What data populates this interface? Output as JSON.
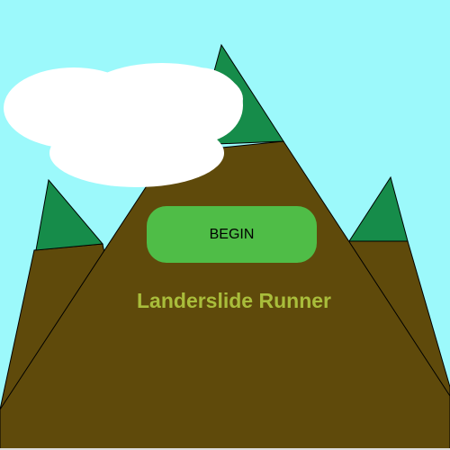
{
  "colors": {
    "sky": "#9cf9fb",
    "mountain": "#5f4a0b",
    "snowcap": "#168c4a",
    "cloud": "#ffffff",
    "button": "#4fbd47",
    "title": "#a9bd3b",
    "button_text": "#000000",
    "border": "#000000",
    "page_border": "#dddddd"
  },
  "menu": {
    "begin_label": "BEGIN",
    "title": "Landerslide Runner"
  }
}
